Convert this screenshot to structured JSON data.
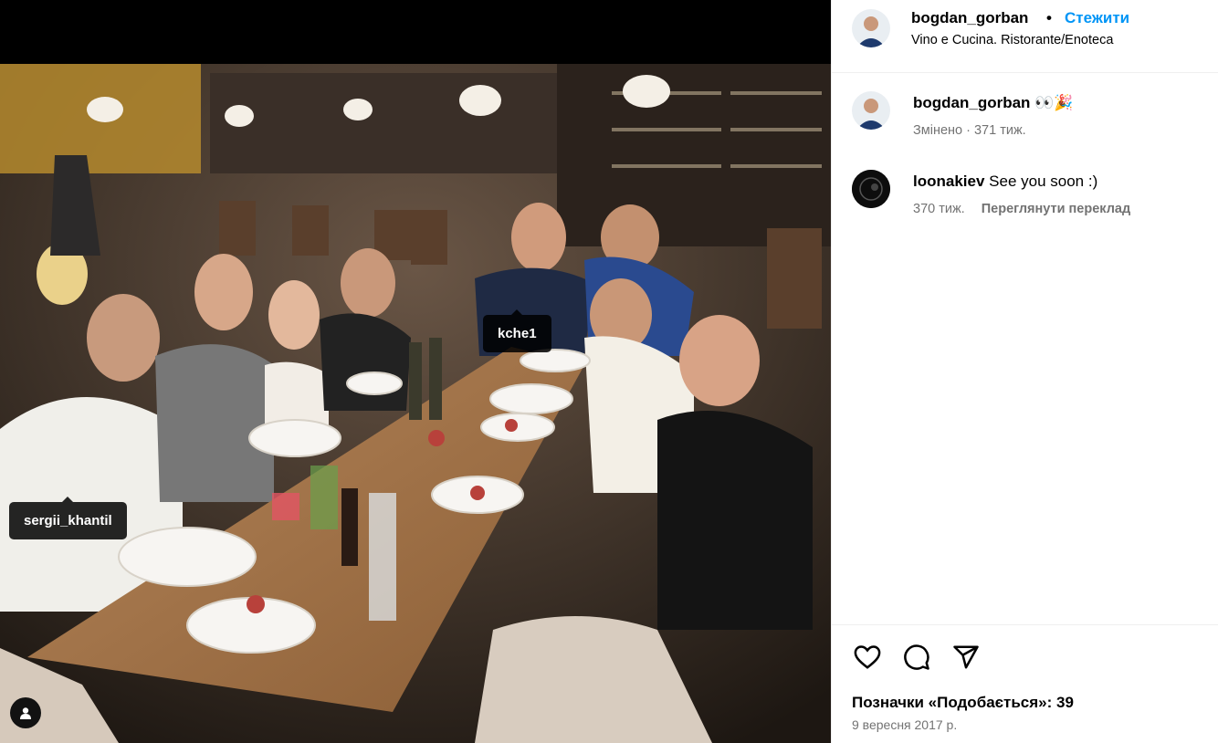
{
  "photo": {
    "tags": [
      "sergii_khantil",
      "kche1"
    ]
  },
  "header": {
    "username": "bogdan_gorban",
    "separator": "•",
    "follow": "Стежити",
    "location": "Vino e Cucina. Ristorante/Enoteca"
  },
  "comments": [
    {
      "username": "bogdan_gorban",
      "text": "👀🎉",
      "meta": "Змінено · 371 тиж.",
      "translate": ""
    },
    {
      "username": "loonakiev",
      "text": "See you soon :)",
      "meta": "370 тиж.",
      "translate": "Переглянути переклад"
    }
  ],
  "footer": {
    "likes": "Позначки «Подобається»: 39",
    "date": "9 вересня 2017 р."
  },
  "colors": {
    "accent": "#0095f6",
    "muted": "#737373",
    "divider": "#efefef"
  },
  "icons": [
    "heart-icon",
    "comment-icon",
    "share-icon",
    "user-tag-icon"
  ]
}
